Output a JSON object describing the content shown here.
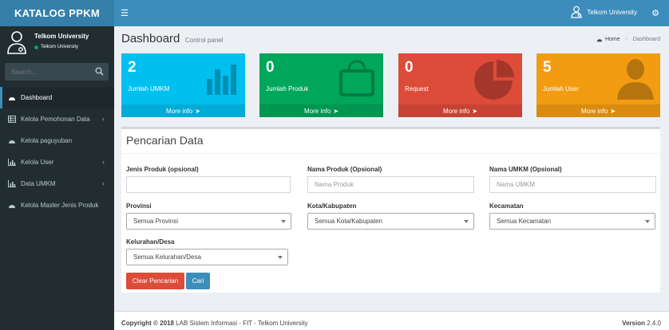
{
  "app": {
    "logo_text": "KATALOG PPKM"
  },
  "navbar": {
    "user_name": "Telkom University"
  },
  "sidebar": {
    "user_name": "Telkom University",
    "user_status": "Telkom University",
    "search_placeholder": "Search...",
    "items": [
      {
        "label": "Dashboard",
        "icon": "dashboard-icon",
        "active": true
      },
      {
        "label": "Kelola Pemohonan Data",
        "icon": "table-icon",
        "has_submenu": true
      },
      {
        "label": "Kelola paguyuban",
        "icon": "dashboard-icon"
      },
      {
        "label": "Kelola User",
        "icon": "bar-chart-icon",
        "has_submenu": true
      },
      {
        "label": "Data UMKM",
        "icon": "bar-chart-icon",
        "has_submenu": true
      },
      {
        "label": "Kelola Master Jenis Produk",
        "icon": "dashboard-icon"
      }
    ]
  },
  "header": {
    "title": "Dashboard",
    "subtitle": "Control panel",
    "breadcrumb_home": "Home",
    "breadcrumb_current": "Dashboard"
  },
  "stats": [
    {
      "value": "2",
      "label": "Jumlah UMKM",
      "more": "More info",
      "color": "#00c0ef",
      "icon": "bar-chart-icon"
    },
    {
      "value": "0",
      "label": "Jumlah Produk",
      "more": "More info",
      "color": "#00a65a",
      "icon": "shopping-bag-icon"
    },
    {
      "value": "0",
      "label": "Request",
      "more": "More info",
      "color": "#dd4b39",
      "icon": "pie-chart-icon"
    },
    {
      "value": "5",
      "label": "Jumlah User",
      "more": "More info",
      "color": "#f39c12",
      "icon": "user-icon"
    }
  ],
  "search_panel": {
    "title": "Pencarian Data",
    "jenis_label": "Jenis Produk (opsional)",
    "jenis_value": "",
    "nama_produk_label": "Nama Produk (Opsional)",
    "nama_produk_placeholder": "Nama Produk",
    "nama_umkm_label": "Nama UMKM (Opsional)",
    "nama_umkm_placeholder": "Nama UMKM",
    "provinsi_label": "Provinsi",
    "provinsi_value": "Semua Provinsi",
    "kota_label": "Kota/Kabupaten",
    "kota_value": "Semua Kota/Kabupaten",
    "kecamatan_label": "Kecamatan",
    "kecamatan_value": "Semua Kecamatan",
    "kelurahan_label": "Kelurahan/Desa",
    "kelurahan_value": "Semua Kelurahan/Desa",
    "clear_label": "Clear Pencarian",
    "search_label": "Cari"
  },
  "footer": {
    "copyright": "Copyright © 2018",
    "org": "LAB Sistem Informasi - FIT - Telkom University",
    "version_label": "Version",
    "version": "2.4.0"
  }
}
